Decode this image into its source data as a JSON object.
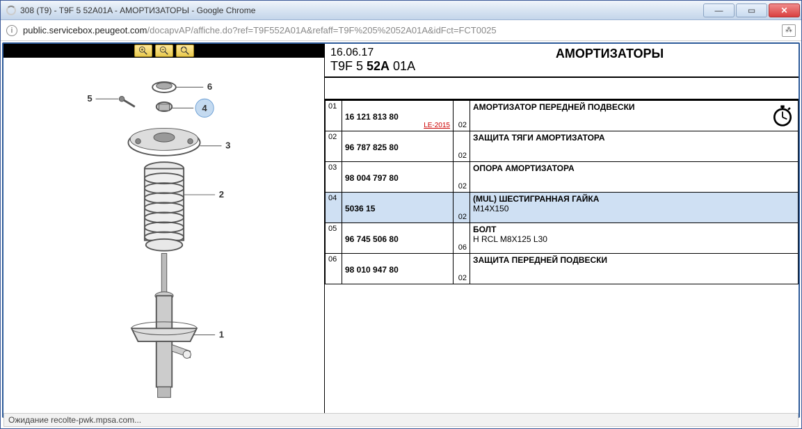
{
  "window": {
    "title": "308 (T9) - T9F 5 52A01A - АМОРТИЗАТОРЫ - Google Chrome"
  },
  "url": {
    "domain": "public.servicebox.peugeot.com",
    "path": "/docapvAP/affiche.do?ref=T9F552A01A&refaff=T9F%205%2052A01A&idFct=FCT0025"
  },
  "header": {
    "date": "16.06.17",
    "code_prefix": "T9F 5 ",
    "code_bold": "52A",
    "code_suffix": " 01A",
    "title": "АМОРТИЗАТОРЫ"
  },
  "diagram": {
    "callouts": [
      "1",
      "2",
      "3",
      "4",
      "5",
      "6"
    ],
    "highlighted": "4"
  },
  "parts": [
    {
      "idx": "01",
      "pn": "16 121 813 80",
      "qty": "02",
      "desc": "АМОРТИЗАТОР ПЕРЕДНЕЙ ПОДВЕСКИ",
      "sub": "",
      "extra": "LE-2015",
      "icon": true
    },
    {
      "idx": "02",
      "pn": "96 787 825 80",
      "qty": "02",
      "desc": "ЗАЩИТА ТЯГИ АМОРТИЗАТОРА",
      "sub": ""
    },
    {
      "idx": "03",
      "pn": "98 004 797 80",
      "qty": "02",
      "desc": "ОПОРА АМОРТИЗАТОРА",
      "sub": ""
    },
    {
      "idx": "04",
      "pn": "5036 15",
      "qty": "02",
      "desc": "(MUL) ШЕСТИГРАННАЯ ГАЙКА",
      "sub": "M14X150",
      "highlight": true
    },
    {
      "idx": "05",
      "pn": "96 745 506 80",
      "qty": "06",
      "desc": "БОЛТ",
      "sub": "H RCL M8X125 L30"
    },
    {
      "idx": "06",
      "pn": "98 010 947 80",
      "qty": "02",
      "desc": "ЗАЩИТА ПЕРЕДНЕЙ ПОДВЕСКИ",
      "sub": ""
    }
  ],
  "status": "Ожидание recolte-pwk.mpsa.com..."
}
